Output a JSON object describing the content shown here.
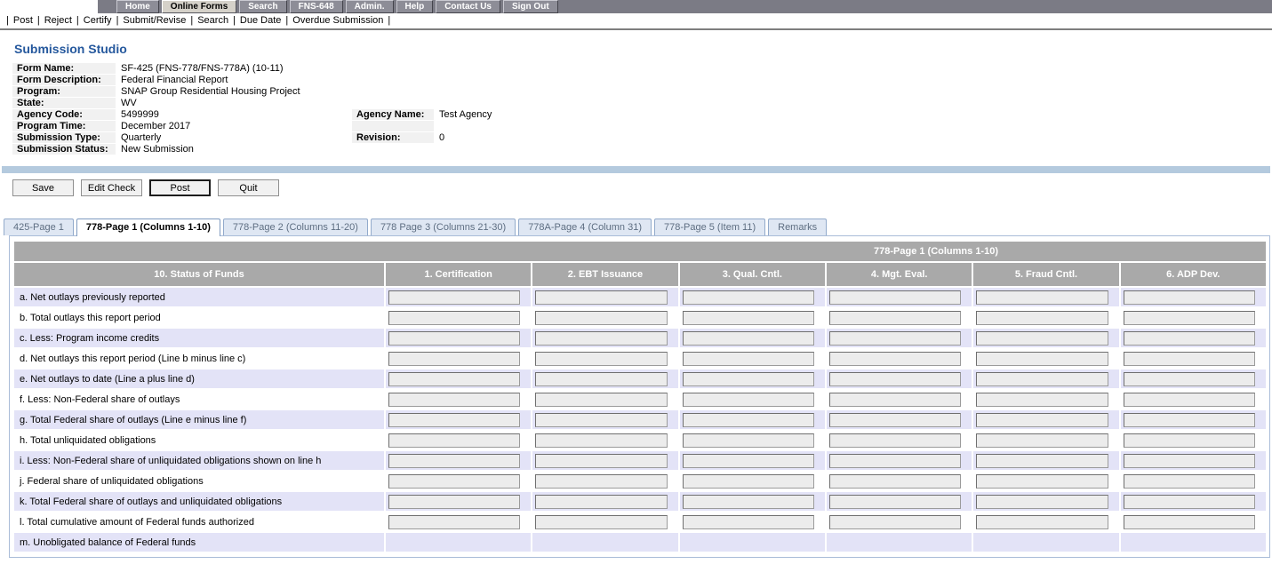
{
  "nav": {
    "items": [
      {
        "label": "Home",
        "active": false
      },
      {
        "label": "Online Forms",
        "active": true
      },
      {
        "label": "Search",
        "active": false
      },
      {
        "label": "FNS-648",
        "active": false
      },
      {
        "label": "Admin.",
        "active": false
      },
      {
        "label": "Help",
        "active": false
      },
      {
        "label": "Contact Us",
        "active": false
      },
      {
        "label": "Sign Out",
        "active": false
      }
    ]
  },
  "menubar": {
    "items": [
      "Post",
      "Reject",
      "Certify",
      "Submit/Revise",
      "Search",
      "Due Date",
      "Overdue Submission"
    ]
  },
  "page_title": "Submission Studio",
  "info": {
    "rows": [
      {
        "label": "Form Name:",
        "value": "SF-425 (FNS-778/FNS-778A) (10-11)"
      },
      {
        "label": "Form Description:",
        "value": "Federal Financial Report"
      },
      {
        "label": "Program:",
        "value": "SNAP Group Residential Housing Project"
      },
      {
        "label": "State:",
        "value": "WV"
      },
      {
        "label": "Agency Code:",
        "value": "5499999",
        "label2": "Agency Name:",
        "value2": "Test Agency"
      },
      {
        "label": "Program Time:",
        "value": "December 2017",
        "label2": "",
        "value2": ""
      },
      {
        "label": "Submission Type:",
        "value": "Quarterly",
        "label2": "Revision:",
        "value2": "0"
      },
      {
        "label": "Submission Status:",
        "value": "New Submission"
      }
    ]
  },
  "actions": {
    "buttons": [
      {
        "label": "Save",
        "default": false
      },
      {
        "label": "Edit Check",
        "default": false
      },
      {
        "label": "Post",
        "default": true
      },
      {
        "label": "Quit",
        "default": false
      }
    ]
  },
  "tabs": [
    {
      "label": "425-Page 1",
      "active": false
    },
    {
      "label": "778-Page 1 (Columns 1-10)",
      "active": true
    },
    {
      "label": "778-Page 2 (Columns 11-20)",
      "active": false
    },
    {
      "label": "778 Page 3 (Columns 21-30)",
      "active": false
    },
    {
      "label": "778A-Page 4 (Column 31)",
      "active": false
    },
    {
      "label": "778-Page 5 (Item 11)",
      "active": false
    },
    {
      "label": "Remarks",
      "active": false
    }
  ],
  "grid": {
    "band_title": "778-Page 1 (Columns 1-10)",
    "columns": [
      "10. Status of Funds",
      "1. Certification",
      "2. EBT Issuance",
      "3. Qual. Cntl.",
      "4. Mgt. Eval.",
      "5. Fraud Cntl.",
      "6. ADP Dev."
    ],
    "rows": [
      {
        "key": "a",
        "label": "a. Net outlays previously reported",
        "has_inputs": true
      },
      {
        "key": "b",
        "label": "b. Total outlays this report period",
        "has_inputs": true
      },
      {
        "key": "c",
        "label": "c. Less: Program income credits",
        "has_inputs": true
      },
      {
        "key": "d",
        "label": "d. Net outlays this report period (Line b minus line c)",
        "has_inputs": true
      },
      {
        "key": "e",
        "label": "e. Net outlays to date (Line a plus line d)",
        "has_inputs": true
      },
      {
        "key": "f",
        "label": "f. Less: Non-Federal share of outlays",
        "has_inputs": true
      },
      {
        "key": "g",
        "label": "g. Total Federal share of outlays (Line e minus line f)",
        "has_inputs": true
      },
      {
        "key": "h",
        "label": "h. Total unliquidated obligations",
        "has_inputs": true
      },
      {
        "key": "i",
        "label": "i. Less: Non-Federal share of unliquidated obligations shown on line h",
        "has_inputs": true
      },
      {
        "key": "j",
        "label": "j. Federal share of unliquidated obligations",
        "has_inputs": true
      },
      {
        "key": "k",
        "label": "k. Total Federal share of outlays and unliquidated obligations",
        "has_inputs": true
      },
      {
        "key": "l",
        "label": "l. Total cumulative amount of Federal funds authorized",
        "has_inputs": true
      },
      {
        "key": "m",
        "label": "m. Unobligated balance of Federal funds",
        "has_inputs": false
      }
    ],
    "input_value": ""
  },
  "colors": {
    "nav_bar_bg": "#7b7b85",
    "nav_button_bg": "#8d8d97",
    "nav_active_bg": "#d5d1c9",
    "title_blue": "#25589d",
    "divider_blue_bar": "#b4cade",
    "table_header_gray": "#a9a9a9",
    "row_lavender": "#e3e3f7",
    "tab_inactive_bg": "#dfe7f3",
    "tab_border": "#92aacb",
    "panel_border": "#a9bcd8",
    "input_bg": "#ececec",
    "info_label_bg": "#f1f1f1"
  }
}
